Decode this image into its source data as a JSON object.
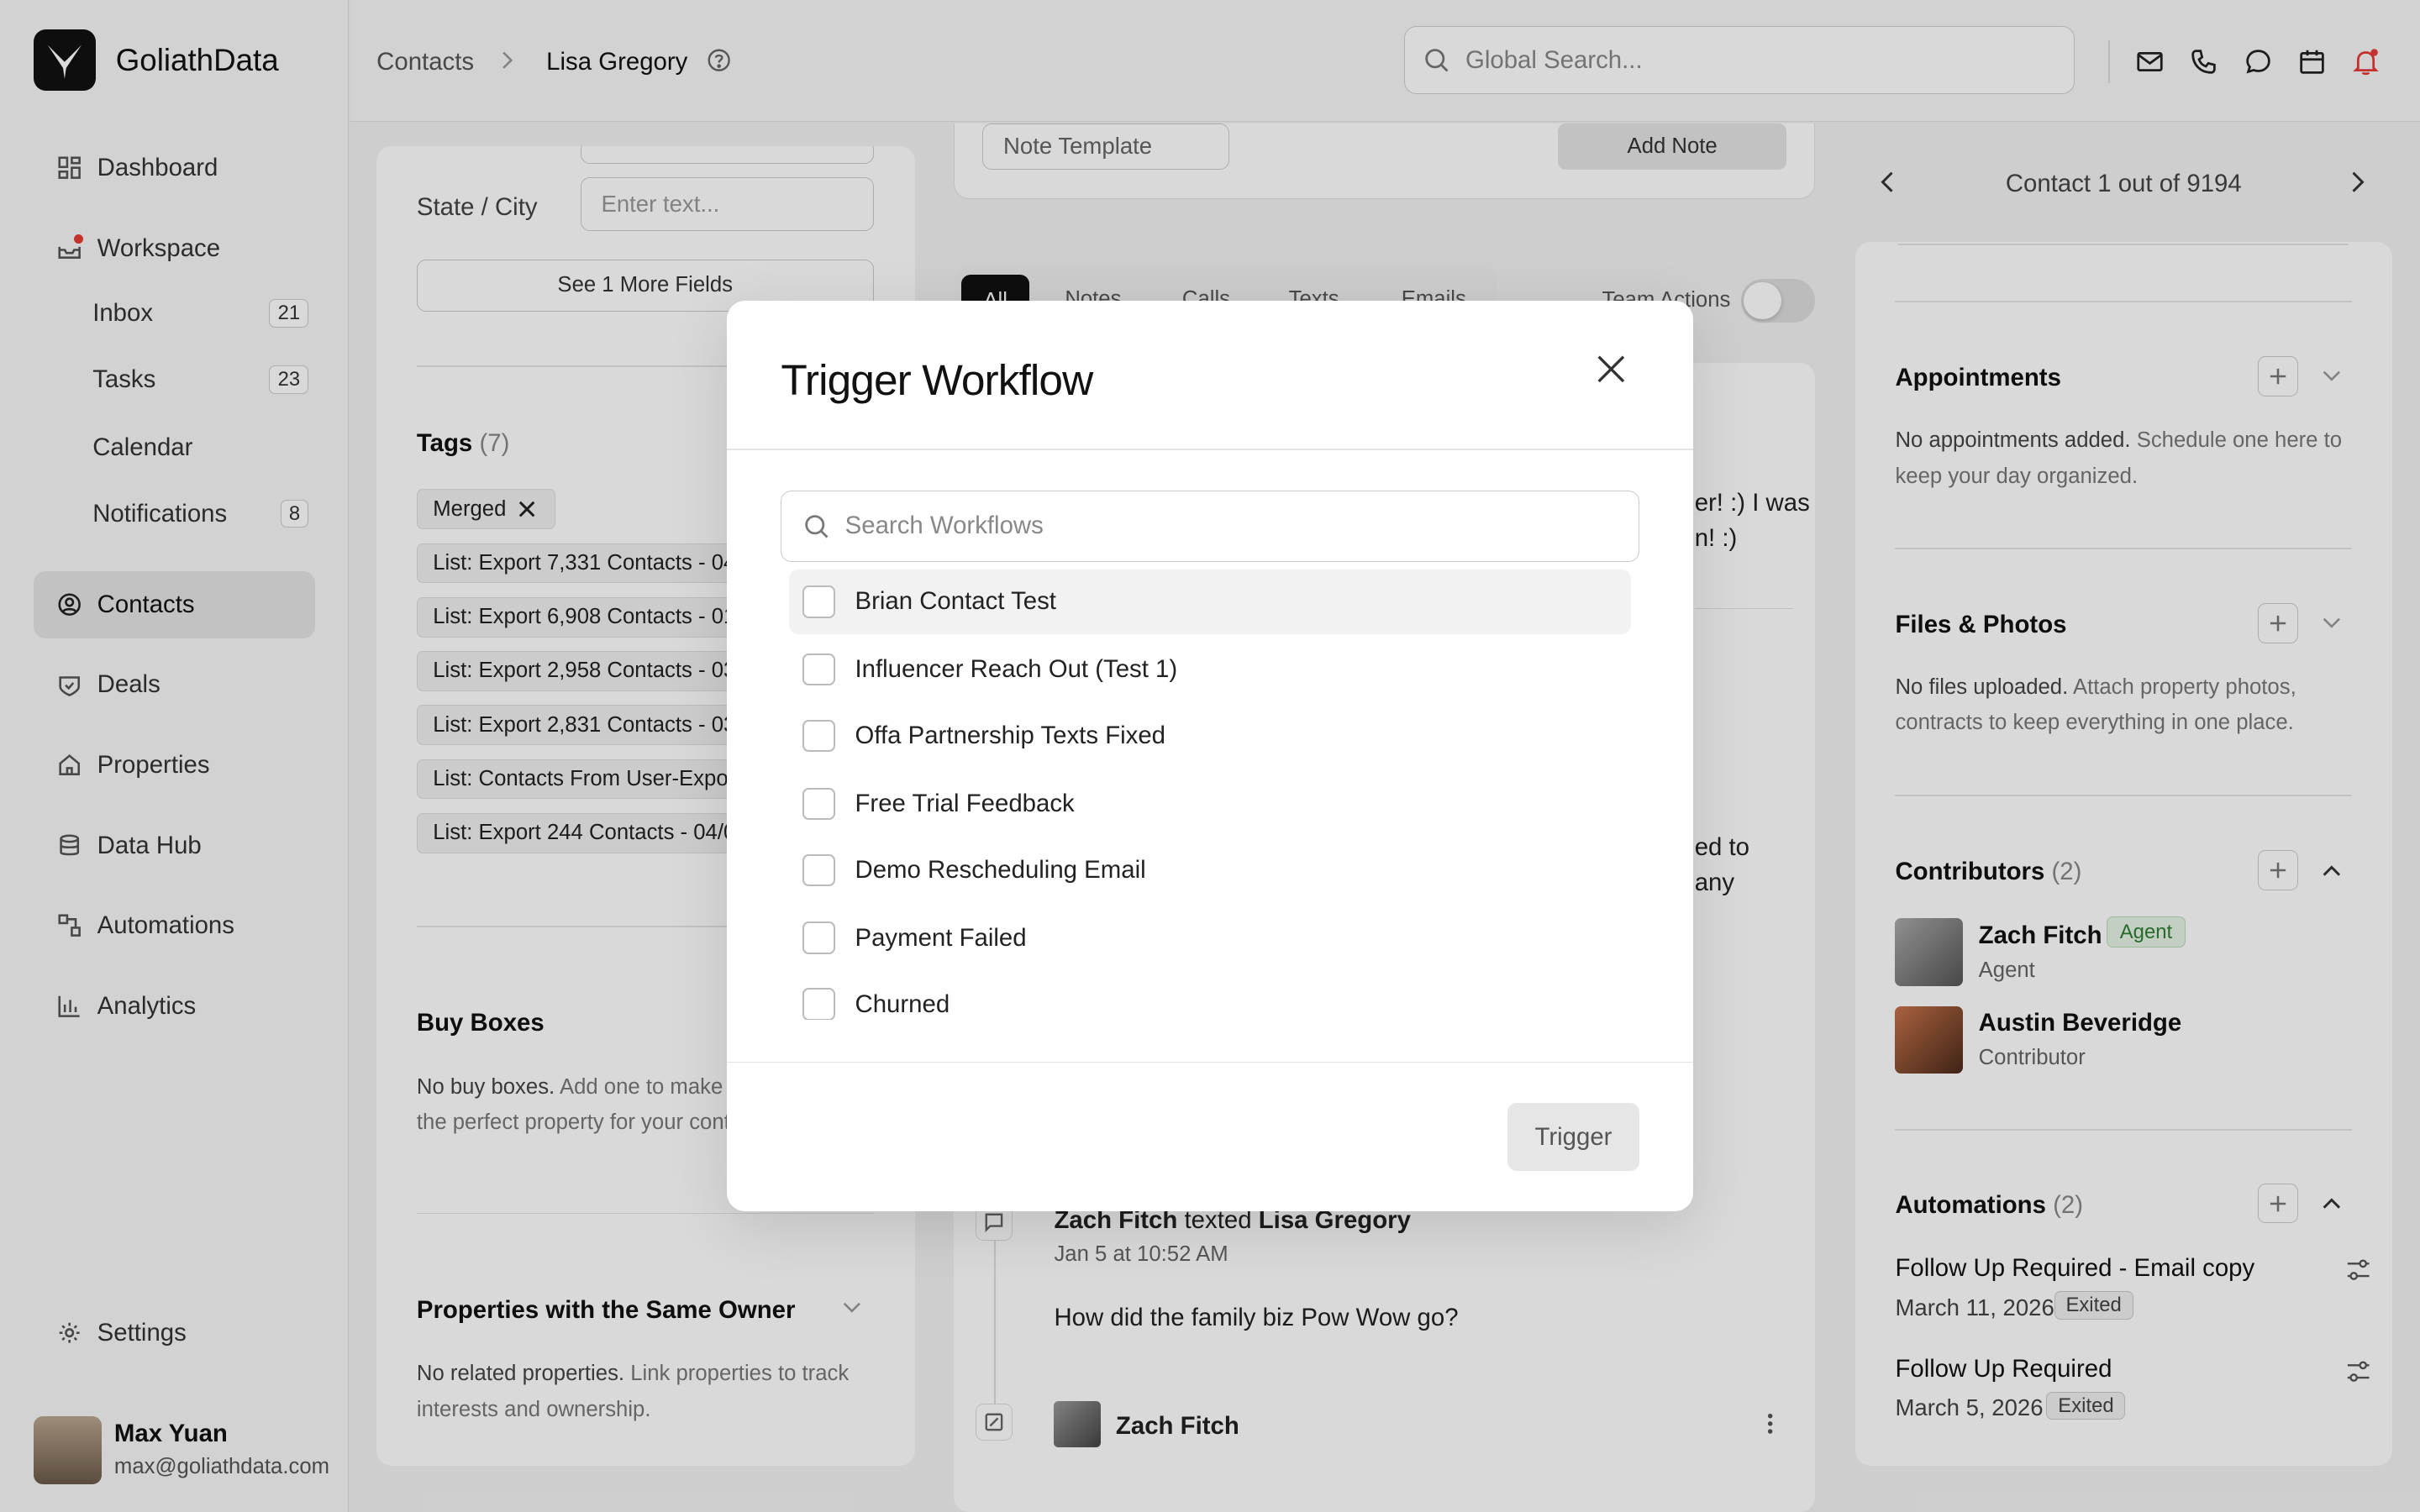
{
  "app": {
    "brand": "GoliathData"
  },
  "sidebar": {
    "dashboard": "Dashboard",
    "workspace": "Workspace",
    "inbox": {
      "label": "Inbox",
      "count": "21"
    },
    "tasks": {
      "label": "Tasks",
      "count": "23"
    },
    "calendar": "Calendar",
    "notifications": {
      "label": "Notifications",
      "count": "8"
    },
    "contacts": "Contacts",
    "deals": "Deals",
    "properties": "Properties",
    "datahub": "Data Hub",
    "automations": "Automations",
    "analytics": "Analytics",
    "settings": "Settings",
    "user": {
      "name": "Max Yuan",
      "email": "max@goliathdata.com"
    }
  },
  "header": {
    "crumb_root": "Contacts",
    "crumb_current": "Lisa Gregory",
    "search_placeholder": "Global Search..."
  },
  "left_panel": {
    "state_city_label": "State / City",
    "state_city_placeholder": "Enter text...",
    "more_fields": "See 1 More Fields",
    "tags_title": "Tags",
    "tags_count": "(7)",
    "tags": [
      "Merged",
      "List: Export 7,331 Contacts - 04/",
      "List: Export 6,908 Contacts - 01,",
      "List: Export 2,958 Contacts - 03",
      "List: Export 2,831 Contacts - 03,",
      "List: Contacts From User-Export",
      "List: Export 244 Contacts - 04/0"
    ],
    "buy_boxes_title": "Buy Boxes",
    "buy_boxes_bold": "No buy boxes.",
    "buy_boxes_text1": "Add one to make it",
    "buy_boxes_text2": "the perfect property for your conta",
    "same_owner_title": "Properties with the Same Owner",
    "same_owner_bold": "No related properties.",
    "same_owner_text1": "Link properties to track",
    "same_owner_text2": "interests and ownership."
  },
  "center_panel": {
    "note_template": "Note Template",
    "add_note": "Add Note",
    "tabs": [
      "All",
      "Notes",
      "Calls",
      "Texts",
      "Emails"
    ],
    "team_actions": "Team Actions",
    "msg_fragment1": "er! :) I was",
    "msg_fragment2": "n! :)",
    "msg_fragment3": "ed to",
    "msg_fragment4": "any",
    "entry_author": "Zach Fitch",
    "entry_verb": "texted",
    "entry_target": "Lisa Gregory",
    "entry_time": "Jan 5 at 10:52 AM",
    "entry_body": "How did the family biz Pow Wow go?",
    "entry2_author": "Zach Fitch"
  },
  "right_panel": {
    "nav_label": "Contact 1 out of 9194",
    "appointments_title": "Appointments",
    "appointments_bold": "No appointments added.",
    "appointments_text1": "Schedule one here to",
    "appointments_text2": "keep your day organized.",
    "files_title": "Files & Photos",
    "files_bold": "No files uploaded.",
    "files_text1": "Attach property photos,",
    "files_text2": "contracts to keep everything in one place.",
    "contributors_title": "Contributors",
    "contributors_count": "(2)",
    "contributors": [
      {
        "name": "Zach Fitch",
        "badge": "Agent",
        "role": "Agent"
      },
      {
        "name": "Austin Beveridge",
        "role": "Contributor"
      }
    ],
    "automations_title": "Automations",
    "automations_count": "(2)",
    "automations": [
      {
        "name": "Follow Up Required - Email copy",
        "date": "March 11, 2026",
        "status": "Exited"
      },
      {
        "name": "Follow Up Required",
        "date": "March 5, 2026",
        "status": "Exited"
      }
    ]
  },
  "modal": {
    "title": "Trigger Workflow",
    "search_placeholder": "Search Workflows",
    "workflows": [
      "Brian Contact Test",
      "Influencer Reach Out (Test 1)",
      "Offa Partnership Texts Fixed",
      "Free Trial Feedback",
      "Demo Rescheduling Email",
      "Payment Failed",
      "Churned"
    ],
    "trigger_label": "Trigger"
  }
}
